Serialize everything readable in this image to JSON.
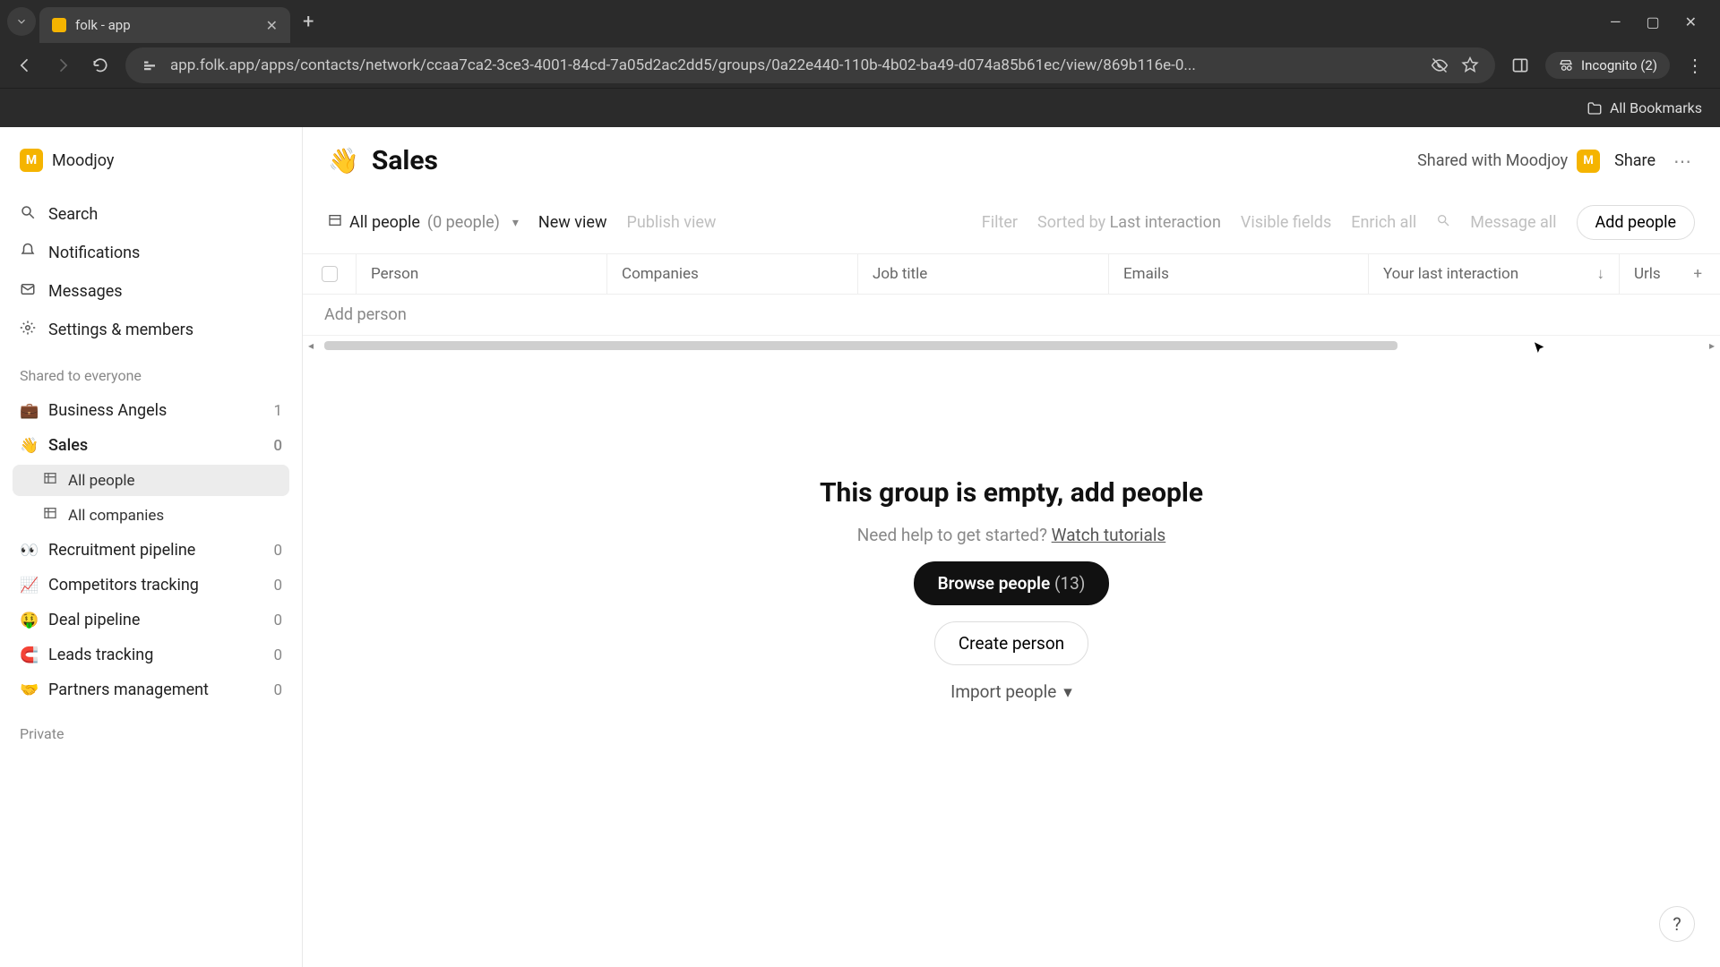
{
  "browser": {
    "tab_title": "folk - app",
    "url": "app.folk.app/apps/contacts/network/ccaa7ca2-3ce3-4001-84cd-7a05d2ac2dd5/groups/0a22e440-110b-4b02-ba49-d074a85b61ec/view/869b116e-0...",
    "incognito_label": "Incognito (2)",
    "all_bookmarks": "All Bookmarks"
  },
  "workspace": {
    "initial": "M",
    "name": "Moodjoy"
  },
  "nav": {
    "search": "Search",
    "notifications": "Notifications",
    "messages": "Messages",
    "settings": "Settings & members"
  },
  "sections": {
    "shared": "Shared to everyone",
    "private": "Private"
  },
  "groups": [
    {
      "emoji": "💼",
      "name": "Business Angels",
      "count": "1"
    },
    {
      "emoji": "👋",
      "name": "Sales",
      "count": "0",
      "active": true,
      "children": [
        {
          "name": "All people",
          "active": true
        },
        {
          "name": "All companies",
          "active": false
        }
      ]
    },
    {
      "emoji": "👀",
      "name": "Recruitment pipeline",
      "count": "0"
    },
    {
      "emoji": "📈",
      "name": "Competitors tracking",
      "count": "0"
    },
    {
      "emoji": "🤑",
      "name": "Deal pipeline",
      "count": "0"
    },
    {
      "emoji": "🧲",
      "name": "Leads tracking",
      "count": "0"
    },
    {
      "emoji": "🤝",
      "name": "Partners management",
      "count": "0"
    }
  ],
  "header": {
    "emoji": "👋",
    "title": "Sales",
    "shared_with": "Shared with Moodjoy",
    "badge": "M",
    "share": "Share"
  },
  "toolbar": {
    "view_name": "All people",
    "view_count": "(0 people)",
    "new_view": "New view",
    "publish": "Publish view",
    "filter": "Filter",
    "sorted_prefix": "Sorted by",
    "sorted_field": "Last interaction",
    "visible_fields": "Visible fields",
    "enrich": "Enrich all",
    "message_all": "Message all",
    "add_people": "Add people"
  },
  "columns": {
    "person": "Person",
    "companies": "Companies",
    "job": "Job title",
    "emails": "Emails",
    "last": "Your last interaction",
    "urls": "Urls"
  },
  "table": {
    "add_person_placeholder": "Add person"
  },
  "empty": {
    "title": "This group is empty, add people",
    "help_prefix": "Need help to get started? ",
    "help_link": "Watch tutorials",
    "browse_label": "Browse people",
    "browse_count": "(13)",
    "create": "Create person",
    "import": "Import people"
  },
  "help_fab": "?"
}
